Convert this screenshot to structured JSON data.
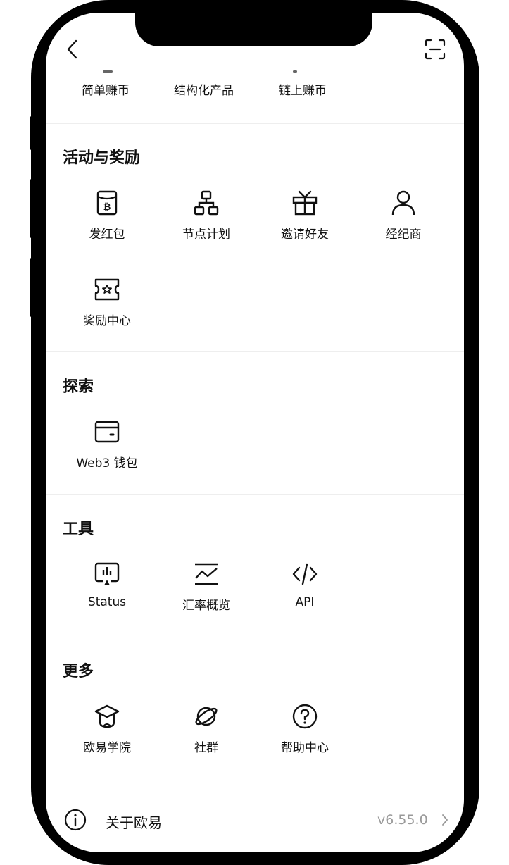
{
  "top_row": [
    "简单赚币",
    "结构化产品",
    "链上赚币"
  ],
  "sections": {
    "rewards": {
      "title": "活动与奖励",
      "items": [
        "发红包",
        "节点计划",
        "邀请好友",
        "经纪商",
        "奖励中心"
      ]
    },
    "explore": {
      "title": "探索",
      "items": [
        "Web3 钱包"
      ]
    },
    "tools": {
      "title": "工具",
      "items": [
        "Status",
        "汇率概览",
        "API"
      ]
    },
    "more": {
      "title": "更多",
      "items": [
        "欧易学院",
        "社群",
        "帮助中心"
      ]
    }
  },
  "about": {
    "label": "关于欧易",
    "version": "v6.55.0"
  },
  "icons": {
    "back": "chevron-left-icon",
    "scan": "scan-icon",
    "red_packet": "red-packet-icon",
    "node_plan": "hierarchy-icon",
    "invite": "gift-icon",
    "broker": "user-icon",
    "reward_center": "ticket-icon",
    "web3_wallet": "wallet-icon",
    "status": "status-monitor-icon",
    "rates": "chart-line-icon",
    "api": "code-icon",
    "academy": "graduation-cap-icon",
    "community": "planet-icon",
    "help": "help-circle-icon",
    "info": "info-icon"
  }
}
